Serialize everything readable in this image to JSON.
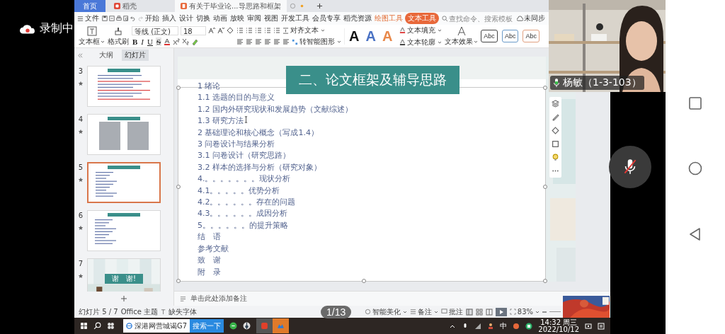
{
  "recording": {
    "label": "录制中"
  },
  "wps": {
    "tabs": [
      {
        "label": "首页",
        "selected": false,
        "kind": "home"
      },
      {
        "label": "稻壳",
        "selected": false,
        "kind": "docer"
      },
      {
        "label": "有关于毕业论...导思路和框架",
        "selected": true,
        "kind": "doc"
      }
    ],
    "menu": {
      "file": "文件",
      "items": [
        {
          "label": "开始",
          "selected": false,
          "kind": "tab"
        },
        {
          "label": "插入",
          "selected": false,
          "kind": "tab"
        },
        {
          "label": "设计",
          "selected": false,
          "kind": "tab"
        },
        {
          "label": "切换",
          "selected": false,
          "kind": "tab"
        },
        {
          "label": "动画",
          "selected": false,
          "kind": "tab"
        },
        {
          "label": "放映",
          "selected": false,
          "kind": "tab"
        },
        {
          "label": "审阅",
          "selected": false,
          "kind": "tab"
        },
        {
          "label": "视图",
          "selected": false,
          "kind": "tab"
        },
        {
          "label": "开发工具",
          "selected": false,
          "kind": "tab"
        },
        {
          "label": "会员专享",
          "selected": false,
          "kind": "tab"
        },
        {
          "label": "稻壳资源",
          "selected": false,
          "kind": "tab"
        },
        {
          "label": "绘图工具",
          "selected": false,
          "kind": "context"
        },
        {
          "label": "文本工具",
          "selected": true,
          "kind": "context"
        }
      ],
      "search": {
        "placeholder": "查找命令、搜索模板"
      },
      "sync": "未同步"
    },
    "ribbon": {
      "textbox": "文本框",
      "format_painter": "格式刷",
      "font": "等线 (正文)",
      "size": "18",
      "format_buttons": [
        "B",
        "I",
        "U",
        "S"
      ],
      "align_text": "对齐文本",
      "smart_art": "转智能图形",
      "style_letters": [
        {
          "letter": "A",
          "color": "#111111"
        },
        {
          "letter": "A",
          "color": "#4a72c4"
        },
        {
          "letter": "A",
          "color": "#e8884a"
        }
      ],
      "text_fill": "文本填充",
      "text_outline": "文本轮廓",
      "text_effect": "文本效果",
      "shape_styles": [
        {
          "label": "Abc",
          "color": "#444444"
        },
        {
          "label": "Abc",
          "color": "#6a9ac8"
        },
        {
          "label": "Abc",
          "color": "#e0a080"
        }
      ]
    },
    "panel_tabs": [
      {
        "label": "大纲",
        "selected": false
      },
      {
        "label": "幻灯片",
        "selected": true
      }
    ],
    "thumbnails": [
      {
        "number": "3",
        "selected": false,
        "kind": "text"
      },
      {
        "number": "4",
        "selected": false,
        "kind": "scans"
      },
      {
        "number": "5",
        "selected": true,
        "kind": "outline"
      },
      {
        "number": "6",
        "selected": false,
        "kind": "outline"
      },
      {
        "number": "7",
        "selected": false,
        "kind": "thanks",
        "caption": "谢　谢!"
      }
    ],
    "slide": {
      "title": "二、论文框架及辅导思路",
      "lines": [
        "1 绪论",
        "1.1 选题的目的与意义",
        "1.2 国内外研究现状和发展趋势（文献综述）",
        "1.3 研究方法",
        "2 基础理论和核心概念（写成1.4）",
        "3 问卷设计与结果分析",
        "3.1 问卷设计（研究思路）",
        "3.2 样本的选择与分析（研究对象）",
        "4.。。。。。。。现状分析",
        "4.1。。。。。优势分析",
        "4.2。。。。。。存在的问题",
        "4.3。。。。。。成因分析",
        "5。。。。。。的提升策略",
        "结　语",
        "参考文献",
        "致　谢",
        "附　录"
      ]
    },
    "notes_placeholder": "单击此处添加备注",
    "status": {
      "slide": "幻灯片 5 / 7",
      "theme": "Office 主题",
      "missing_fonts": "缺失字体",
      "beautify": "智能美化",
      "notes": "备注",
      "comments": "批注",
      "zoom": "83%"
    },
    "page_counter": "1/13",
    "taskbar": {
      "search_box": "深港网营城谒G7",
      "search_button": "搜索一下",
      "ime": "中",
      "time": "14:32 周三",
      "date": "2022/10/12"
    }
  },
  "video": {
    "name": "杨敏（1-3-103）"
  }
}
